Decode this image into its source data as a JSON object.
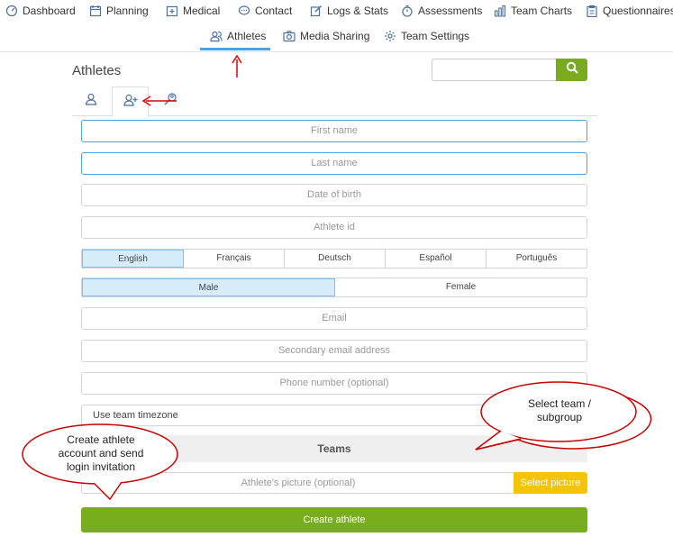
{
  "nav_top": [
    {
      "label": "Dashboard",
      "icon": "dashboard-icon"
    },
    {
      "label": "Planning",
      "icon": "calendar-icon"
    },
    {
      "label": "Medical",
      "icon": "medical-icon"
    },
    {
      "label": "Contact",
      "icon": "chat-icon"
    },
    {
      "label": "Logs & Stats",
      "icon": "edit-icon"
    },
    {
      "label": "Assessments",
      "icon": "stopwatch-icon"
    },
    {
      "label": "Team Charts",
      "icon": "bar-chart-icon"
    },
    {
      "label": "Questionnaires",
      "icon": "clipboard-icon"
    }
  ],
  "nav_sub": [
    {
      "label": "Athletes",
      "icon": "users-icon"
    },
    {
      "label": "Media Sharing",
      "icon": "camera-icon"
    },
    {
      "label": "Team Settings",
      "icon": "gear-icon"
    }
  ],
  "page": {
    "title": "Athletes"
  },
  "search": {
    "placeholder": "",
    "value": ""
  },
  "form": {
    "first_name": "First name",
    "last_name": "Last name",
    "dob": "Date of birth",
    "athlete_id": "Athlete id",
    "languages": [
      "English",
      "Français",
      "Deutsch",
      "Español",
      "Português"
    ],
    "selected_language": "English",
    "genders": [
      "Male",
      "Female"
    ],
    "selected_gender": "Male",
    "email": "Email",
    "secondary_email": "Secondary email address",
    "phone": "Phone number (optional)",
    "timezone": "Use team timezone",
    "teams": "Teams",
    "picture": "Athlete's picture (optional)",
    "select_picture": "Select picture",
    "create": "Create athlete"
  },
  "callouts": {
    "team": "Select team / subgroup",
    "create": "Create athlete account and send login invitation"
  },
  "colors": {
    "accent": "#4aa3df",
    "green": "#78ad1e",
    "yellow": "#f5c400",
    "annotation": "#e00000"
  }
}
